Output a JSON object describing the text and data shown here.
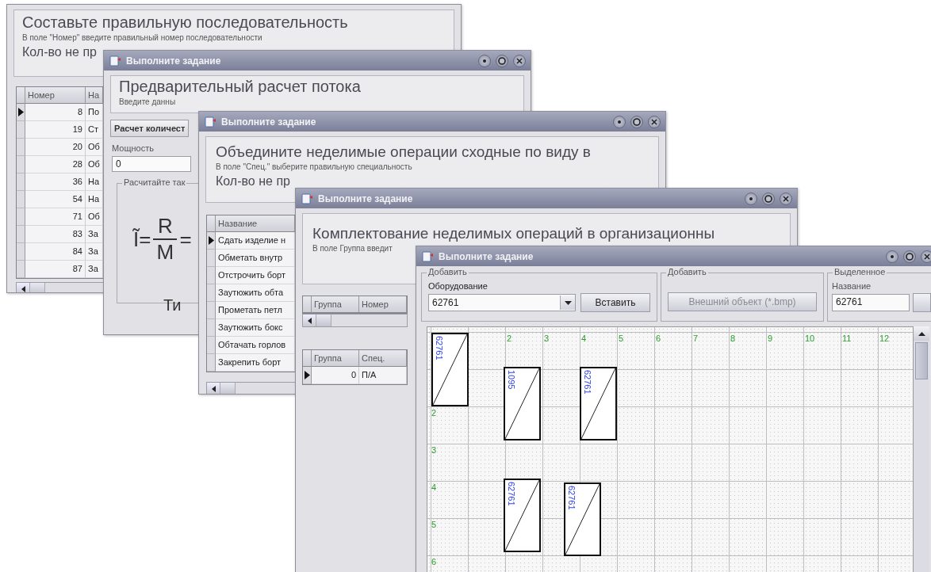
{
  "sequence_window": {
    "heading": "Составьте правильную последовательность",
    "hint": "В поле \"Номер\" введите правильный номер последовательности",
    "count": "Кол-во не пр",
    "table": {
      "columns": [
        "Номер",
        "На"
      ],
      "rows": [
        {
          "number": "8",
          "name": "По",
          "selected": true
        },
        {
          "number": "19",
          "name": "Ст",
          "selected": false
        },
        {
          "number": "20",
          "name": "Об",
          "selected": false
        },
        {
          "number": "28",
          "name": "Об",
          "selected": false
        },
        {
          "number": "36",
          "name": "На",
          "selected": false
        },
        {
          "number": "54",
          "name": "На",
          "selected": false
        },
        {
          "number": "71",
          "name": "Об",
          "selected": false
        },
        {
          "number": "83",
          "name": "За",
          "selected": false
        },
        {
          "number": "84",
          "name": "За",
          "selected": false
        },
        {
          "number": "87",
          "name": "За",
          "selected": false
        }
      ]
    }
  },
  "flow_window": {
    "title": "Выполните задание",
    "heading": "Предварительный расчет потока",
    "hint": "Введите данны",
    "tab": "Расчет количест",
    "power": {
      "label": "Мощность",
      "value": "0"
    },
    "group_legend": "Расчитайте так",
    "formula": {
      "lhs": "Ĩ=",
      "numerator": "R",
      "denominator": "M",
      "eq": "=",
      "lower": "Ти"
    }
  },
  "merge_window": {
    "title": "Выполните задание",
    "heading": "Объедините неделимые операции сходные по виду в",
    "hint": "В поле \"Спец.\" выберите правильную специальность",
    "count": "Кол-во не пр",
    "table": {
      "columns": [
        "Название"
      ],
      "rows": [
        {
          "name": "Сдать изделие н",
          "selected": true
        },
        {
          "name": "Обметать внутр",
          "selected": false
        },
        {
          "name": "Отстрочить борт",
          "selected": false
        },
        {
          "name": "Заутюжить обта",
          "selected": false
        },
        {
          "name": "Прометать петл",
          "selected": false
        },
        {
          "name": "Заутюжить бокс",
          "selected": false
        },
        {
          "name": "Обтачать горлов",
          "selected": false
        },
        {
          "name": "Закрепить борт",
          "selected": false
        }
      ]
    }
  },
  "grouping_window": {
    "title": "Выполните задание",
    "heading": "Комплектование неделимых операций в организационны",
    "hint": "В поле Группа введит",
    "table_1": {
      "columns": [
        "Группа",
        "Номер"
      ]
    },
    "table_2": {
      "columns": [
        "Группа",
        "Спец."
      ],
      "rows": [
        {
          "group": "0",
          "spec": "П/А",
          "selected": true
        }
      ]
    }
  },
  "layout_window": {
    "title": "Выполните задание",
    "equipment_group": {
      "legend": "Добавить",
      "label": "Оборудование",
      "value": "62761",
      "button": "Вставить"
    },
    "import_group": {
      "legend": "Добавить",
      "button": {
        "label": "Внешний объект (*.bmp)",
        "disabled": true
      }
    },
    "selection_group": {
      "legend": "Выделенное",
      "label": "Название",
      "value": "62761"
    },
    "canvas": {
      "column_labels": [
        "2",
        "3",
        "4",
        "5",
        "6",
        "7",
        "8",
        "9",
        "10",
        "11",
        "12"
      ],
      "row_labels": [
        "2",
        "3",
        "4",
        "5",
        "6"
      ],
      "nodes": [
        {
          "label": "62761"
        },
        {
          "label": "1095"
        },
        {
          "label": "62761"
        },
        {
          "label": "62761"
        },
        {
          "label": "62761"
        }
      ]
    }
  }
}
